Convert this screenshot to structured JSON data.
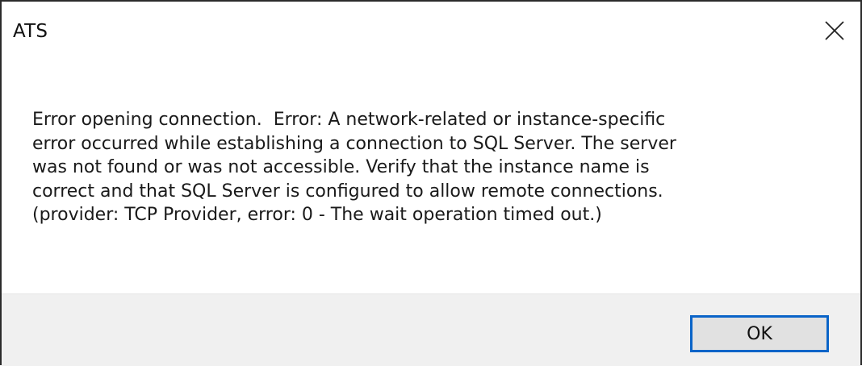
{
  "window": {
    "title": "ATS"
  },
  "message": {
    "lines": [
      "Error opening connection.  Error: A network-related or instance-specific",
      "error occurred while establishing a connection to SQL Server. The server",
      "was not found or was not accessible. Verify that the instance name is",
      "correct and that SQL Server is configured to allow remote connections.",
      "(provider: TCP Provider, error: 0 - The wait operation timed out.)"
    ]
  },
  "buttons": {
    "ok_label": "OK"
  },
  "icons": {
    "close": "close-icon"
  },
  "colors": {
    "accent_border": "#0a64c8",
    "footer_background": "#f0f0f0",
    "button_background": "#e1e1e1"
  }
}
